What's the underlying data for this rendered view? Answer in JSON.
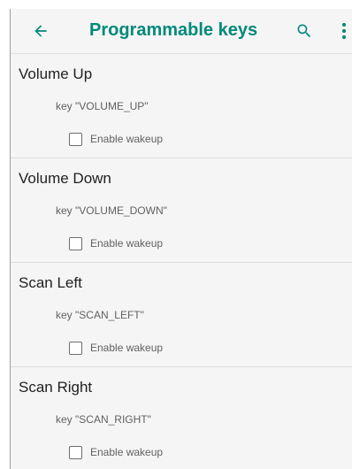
{
  "app_bar": {
    "title": "Programmable keys",
    "accent_color": "#00897b"
  },
  "icons": {
    "back": "arrow-left-icon",
    "search": "search-icon",
    "more": "more-vert-icon"
  },
  "keys": [
    {
      "title": "Volume Up",
      "summary": "key \"VOLUME_UP\"",
      "wakeup_label": "Enable wakeup",
      "wakeup_checked": false
    },
    {
      "title": "Volume Down",
      "summary": "key \"VOLUME_DOWN\"",
      "wakeup_label": "Enable wakeup",
      "wakeup_checked": false
    },
    {
      "title": "Scan Left",
      "summary": "key \"SCAN_LEFT\"",
      "wakeup_label": "Enable wakeup",
      "wakeup_checked": false
    },
    {
      "title": "Scan Right",
      "summary": "key \"SCAN_RIGHT\"",
      "wakeup_label": "Enable wakeup",
      "wakeup_checked": false
    }
  ]
}
